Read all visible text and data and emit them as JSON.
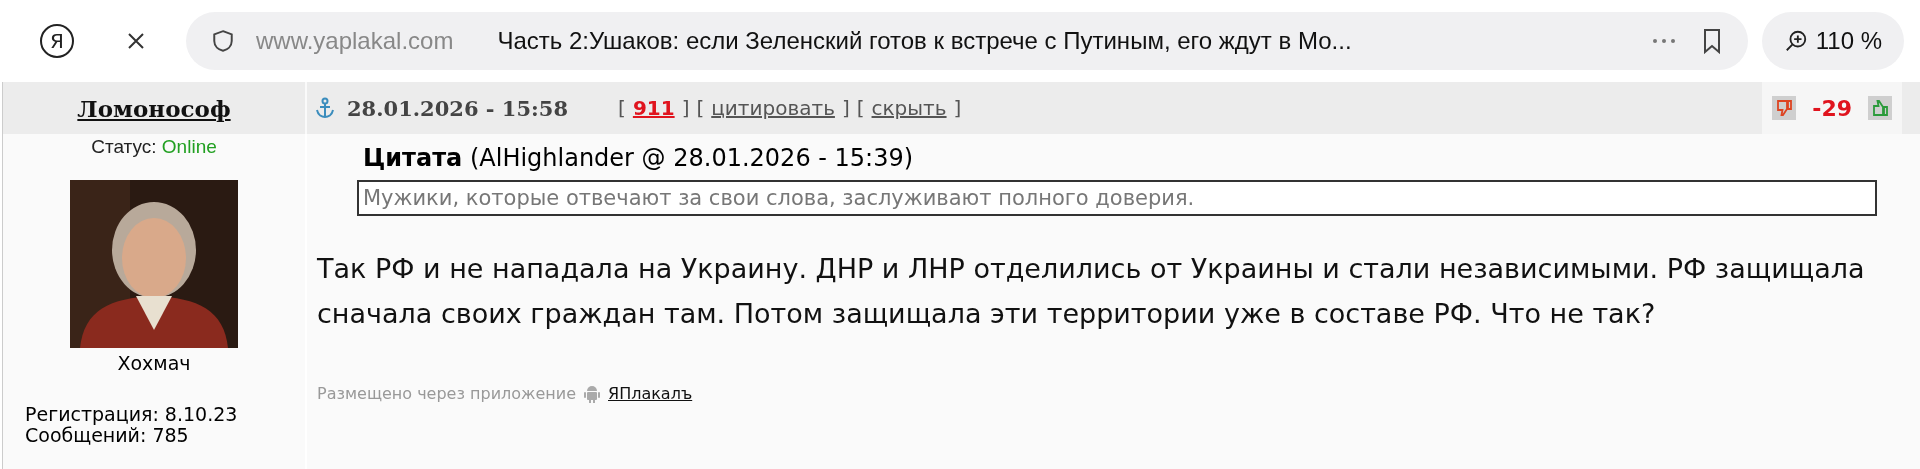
{
  "browser": {
    "logo": "Я",
    "url": "www.yaplakal.com",
    "title": "Часть 2:Ушаков: если Зеленский готов к встрече с Путиным, его ждут в Мо...",
    "zoom": "110 %"
  },
  "post": {
    "author": "Ломонософ",
    "date": "28.01.2026 - 15:58",
    "open_bracket": "[",
    "close_bracket": "]",
    "links": [
      {
        "kind": "number",
        "label": "911"
      },
      {
        "kind": "action",
        "label": "цитировать"
      },
      {
        "kind": "action",
        "label": "скрыть"
      }
    ],
    "rating": "-29",
    "status_label": "Статус:",
    "status": "Online",
    "user_title": "Хохмач",
    "registration": "Регистрация: 8.10.23",
    "messages": "Сообщений: 785",
    "quote": {
      "header": "**Цитата** (AlHighlander @ 28.01.2026 - 15:39)",
      "text": "Мужики, которые отвечают за свои слова, заслуживают полного доверия."
    },
    "body": "Так РФ и не нападала на Украину. ДНР и ЛНР отделились от Украины и стали независимыми. РФ защищала сначала своих граждан там. Потом защищала эти территории уже в составе РФ. Что не так?",
    "footer": {
      "text": "Размещено через приложение",
      "app": "ЯПлакалъ"
    }
  }
}
